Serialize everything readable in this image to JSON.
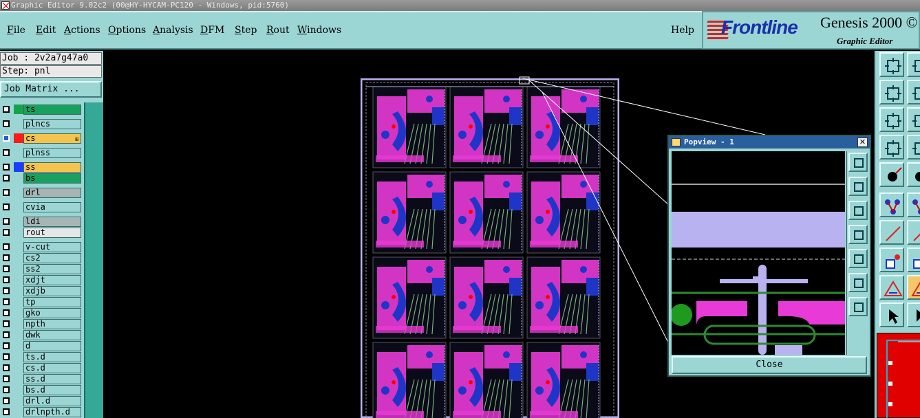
{
  "window": {
    "title": "Graphic Editor 9.02c2 (00@HY-HYCAM-PC120 - Windows, pid:5760)"
  },
  "menubar": {
    "items": [
      {
        "label": "File",
        "key": "F"
      },
      {
        "label": "Edit",
        "key": "E"
      },
      {
        "label": "Actions",
        "key": "A"
      },
      {
        "label": "Options",
        "key": "O"
      },
      {
        "label": "Analysis",
        "key": "A"
      },
      {
        "label": "DFM",
        "key": "D"
      },
      {
        "label": "Step",
        "key": "S"
      },
      {
        "label": "Rout",
        "key": "R"
      },
      {
        "label": "Windows",
        "key": "W"
      }
    ],
    "help": "Help"
  },
  "brand": {
    "logo": "Frontline",
    "product": "Genesis 2000 ©",
    "subtitle": "Graphic Editor",
    "logo_color": "#1a2fa8",
    "accent_color": "#d22222"
  },
  "job": {
    "job_label": "Job : 2v2a7g47a0",
    "step_label": "Step: pnl",
    "matrix_button": "Job Matrix ..."
  },
  "layers": [
    {
      "name": "ts",
      "swatch": "#16a34a",
      "bg": "#1aa05e",
      "active": false
    },
    {
      "name": "plncs",
      "swatch": "",
      "bg": "#9bd6d4",
      "active": false
    },
    {
      "name": "cs",
      "swatch": "#ff1a1a",
      "bg": "#f5c44c",
      "active": true,
      "marker": "⊞"
    },
    {
      "name": "plnss",
      "swatch": "",
      "bg": "#9bd6d4",
      "active": false
    },
    {
      "name": "ss",
      "swatch": "#1a3dff",
      "bg": "#f5c44c",
      "active": false
    },
    {
      "name": "bs",
      "swatch": "",
      "bg": "#1aa05e",
      "active": false
    },
    {
      "name": "drl",
      "swatch": "",
      "bg": "#a7b4b4",
      "active": false
    },
    {
      "name": "cvia",
      "swatch": "",
      "bg": "#9bd6d4",
      "active": false
    },
    {
      "name": "ldi",
      "swatch": "",
      "bg": "#a7b4b4",
      "active": false
    },
    {
      "name": "rout",
      "swatch": "",
      "bg": "#e6e6e6",
      "active": false
    },
    {
      "name": "v-cut",
      "swatch": "",
      "bg": "#9bd6d4",
      "active": false
    },
    {
      "name": "cs2",
      "swatch": "",
      "bg": "#9bd6d4",
      "active": false
    },
    {
      "name": "ss2",
      "swatch": "",
      "bg": "#9bd6d4",
      "active": false
    },
    {
      "name": "xdjt",
      "swatch": "",
      "bg": "#9bd6d4",
      "active": false
    },
    {
      "name": "xdjb",
      "swatch": "",
      "bg": "#9bd6d4",
      "active": false
    },
    {
      "name": "tp",
      "swatch": "",
      "bg": "#9bd6d4",
      "active": false
    },
    {
      "name": "gko",
      "swatch": "",
      "bg": "#9bd6d4",
      "active": false
    },
    {
      "name": "npth",
      "swatch": "",
      "bg": "#9bd6d4",
      "active": false
    },
    {
      "name": "dwk",
      "swatch": "",
      "bg": "#9bd6d4",
      "active": false
    },
    {
      "name": "d",
      "swatch": "",
      "bg": "#9bd6d4",
      "active": false
    },
    {
      "name": "ts.d",
      "swatch": "",
      "bg": "#9bd6d4",
      "active": false
    },
    {
      "name": "cs.d",
      "swatch": "",
      "bg": "#9bd6d4",
      "active": false
    },
    {
      "name": "ss.d",
      "swatch": "",
      "bg": "#9bd6d4",
      "active": false
    },
    {
      "name": "bs.d",
      "swatch": "",
      "bg": "#9bd6d4",
      "active": false
    },
    {
      "name": "drl.d",
      "swatch": "",
      "bg": "#9bd6d4",
      "active": false
    },
    {
      "name": "drlnpth.d",
      "swatch": "",
      "bg": "#9bd6d4",
      "active": false
    }
  ],
  "board": {
    "rows": 4,
    "cols": 3,
    "copper_color": "#e83ad6",
    "dielectric_color": "#1f35c8",
    "trace_color": "#7ab07a",
    "outline_color": "#b9b2f0"
  },
  "popview": {
    "title": "Popview - 1",
    "close_button": "Close"
  },
  "right_tools": {
    "icons": [
      "zoom-home-icon",
      "zoom-fit-icon",
      "zoom-in-icon",
      "zoom-out-icon",
      "pan-left-icon",
      "pan-right-icon",
      "grid-icon",
      "snap-icon",
      "measure-icon",
      "probe-icon",
      "connect-icon",
      "node-icon",
      "line-icon",
      "arc-icon",
      "pad-icon",
      "fill-icon",
      "polygon-icon",
      "arrow-select-icon",
      "triangle-icon",
      "select-icon"
    ]
  }
}
